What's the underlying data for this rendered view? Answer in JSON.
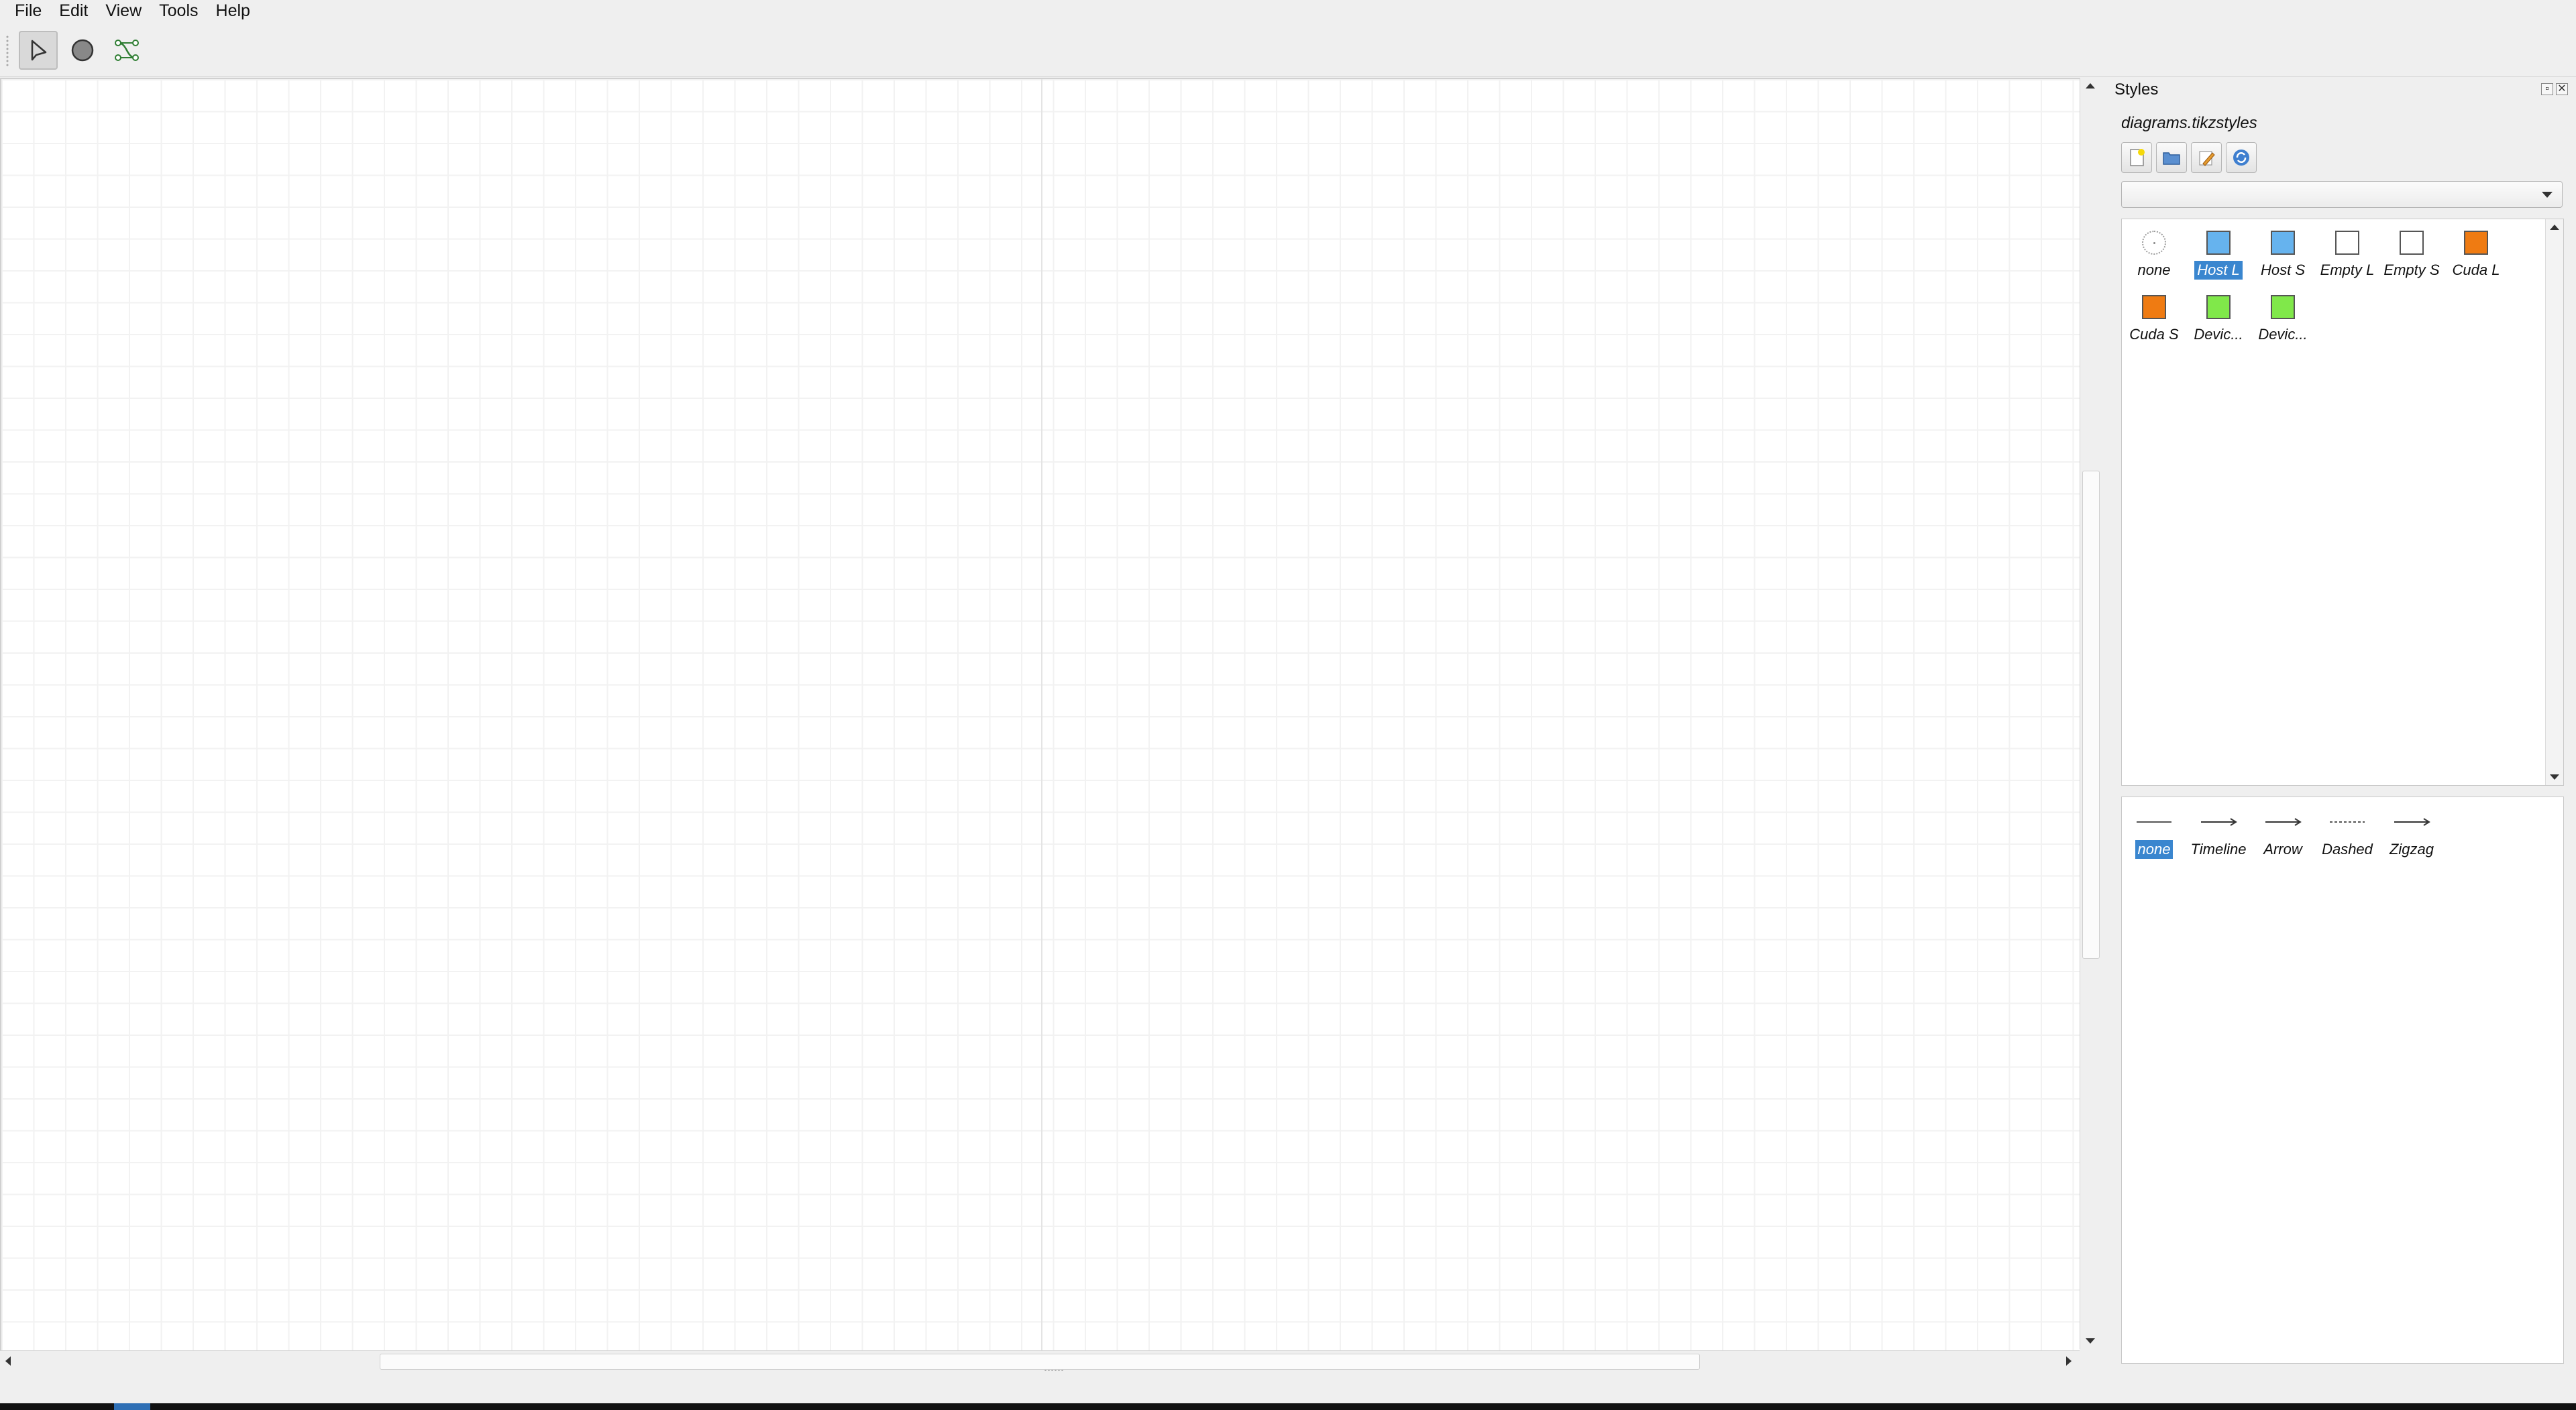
{
  "menubar": {
    "items": [
      "File",
      "Edit",
      "View",
      "Tools",
      "Help"
    ]
  },
  "toolbar": {
    "tools": [
      {
        "name": "select-tool",
        "icon": "pointer-arrow-icon",
        "active": true
      },
      {
        "name": "node-tool",
        "icon": "circle-node-icon",
        "active": false
      },
      {
        "name": "edge-tool",
        "icon": "edge-path-icon",
        "active": false
      }
    ]
  },
  "styles_dock": {
    "title": "Styles",
    "file_name": "diagrams.tikzstyles",
    "buttons": [
      "new-file-icon",
      "open-folder-icon",
      "edit-icon",
      "refresh-icon"
    ],
    "combo_value": "",
    "node_styles": [
      {
        "label": "none",
        "fill": "none",
        "selected": false
      },
      {
        "label": "Host L",
        "fill": "#66b3ee",
        "selected": true
      },
      {
        "label": "Host S",
        "fill": "#66b3ee",
        "selected": false
      },
      {
        "label": "Empty L",
        "fill": "#ffffff",
        "selected": false
      },
      {
        "label": "Empty S",
        "fill": "#ffffff",
        "selected": false
      },
      {
        "label": "Cuda L",
        "fill": "#ef7b12",
        "selected": false
      },
      {
        "label": "Cuda S",
        "fill": "#ef7b12",
        "selected": false
      },
      {
        "label": "Devic...",
        "fill": "#80e84a",
        "selected": false
      },
      {
        "label": "Devic...",
        "fill": "#80e84a",
        "selected": false
      }
    ],
    "edge_styles": [
      {
        "label": "none",
        "kind": "plain",
        "selected": true
      },
      {
        "label": "Timeline",
        "kind": "arrow",
        "selected": false
      },
      {
        "label": "Arrow",
        "kind": "arrow",
        "selected": false
      },
      {
        "label": "Dashed",
        "kind": "dashed",
        "selected": false
      },
      {
        "label": "Zigzag",
        "kind": "arrow",
        "selected": false
      }
    ]
  }
}
